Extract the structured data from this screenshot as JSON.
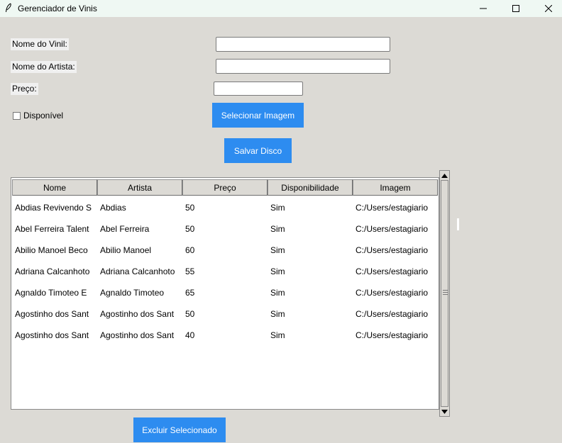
{
  "window": {
    "title": "Gerenciador de Vinis",
    "icon": "feather-icon"
  },
  "form": {
    "nome_vinil_label": "Nome do Vinil:",
    "nome_vinil_value": "",
    "nome_artista_label": "Nome do Artista:",
    "nome_artista_value": "",
    "preco_label": "Preço:",
    "preco_value": "",
    "disponivel_label": "Disponível",
    "disponivel_checked": false,
    "select_image_label": "Selecionar Imagem",
    "save_label": "Salvar Disco"
  },
  "table": {
    "columns": [
      "Nome",
      "Artista",
      "Preço",
      "Disponibilidade",
      "Imagem"
    ],
    "rows": [
      [
        "Abdias Revivendo S",
        "Abdias",
        "50",
        "Sim",
        "C:/Users/estagiario"
      ],
      [
        "Abel Ferreira Talent",
        "Abel Ferreira",
        "50",
        "Sim",
        "C:/Users/estagiario"
      ],
      [
        "Abilio Manoel Beco",
        "Abilio Manoel",
        "60",
        "Sim",
        "C:/Users/estagiario"
      ],
      [
        "Adriana Calcanhoto",
        "Adriana Calcanhoto",
        "55",
        "Sim",
        "C:/Users/estagiario"
      ],
      [
        "Agnaldo Timoteo E",
        "Agnaldo Timoteo",
        "65",
        "Sim",
        "C:/Users/estagiario"
      ],
      [
        "Agostinho dos Sant",
        "Agostinho dos Sant",
        "50",
        "Sim",
        "C:/Users/estagiario"
      ],
      [
        "Agostinho dos Sant",
        "Agostinho dos Sant",
        "40",
        "Sim",
        "C:/Users/estagiario"
      ]
    ]
  },
  "actions": {
    "delete_label": "Excluir Selecionado"
  },
  "colors": {
    "button": "#2d8cf0",
    "background": "#dcdad5",
    "titlebar": "#eff8f3"
  }
}
